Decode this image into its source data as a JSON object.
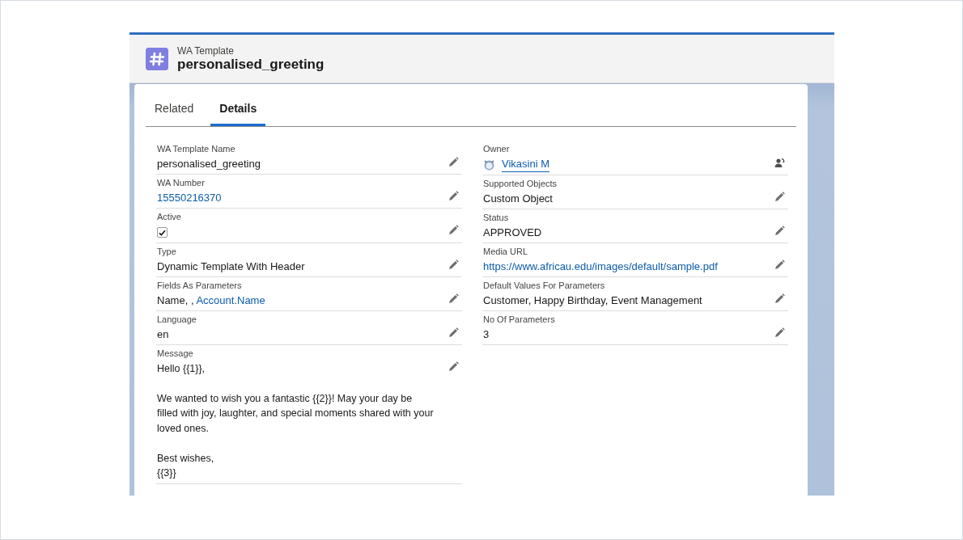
{
  "header": {
    "object_label": "WA Template",
    "record_name": "personalised_greeting"
  },
  "tabs": [
    {
      "label": "Related",
      "selected": false
    },
    {
      "label": "Details",
      "selected": true
    }
  ],
  "left_fields": [
    {
      "label": "WA Template Name",
      "kind": "text",
      "value": "personalised_greeting",
      "editable": true
    },
    {
      "label": "WA Number",
      "kind": "link",
      "value": "15550216370",
      "editable": true
    },
    {
      "label": "Active",
      "kind": "checkbox",
      "checked": true,
      "editable": true
    },
    {
      "label": "Type",
      "kind": "text",
      "value": "Dynamic Template With Header",
      "editable": true
    },
    {
      "label": "Fields As Parameters",
      "kind": "mixed",
      "value": "Name, , ",
      "link": "Account.Name",
      "editable": true
    },
    {
      "label": "Language",
      "kind": "text",
      "value": "en",
      "editable": true
    },
    {
      "label": "Message",
      "kind": "multiline",
      "paragraphs": [
        [
          "Hello {{1}},"
        ],
        [
          "We wanted to wish you a fantastic {{2}}! May your day be",
          "filled with joy, laughter, and special moments shared with your",
          "loved ones."
        ],
        [
          "Best wishes,",
          "{{3}}"
        ]
      ],
      "editable": true
    }
  ],
  "right_fields": [
    {
      "label": "Owner",
      "kind": "owner",
      "value": "Vikasini M",
      "editable": true
    },
    {
      "label": "Supported Objects",
      "kind": "text",
      "value": "Custom Object",
      "editable": true
    },
    {
      "label": "Status",
      "kind": "text",
      "value": "APPROVED",
      "editable": true
    },
    {
      "label": "Media URL",
      "kind": "link",
      "value": "https://www.africau.edu/images/default/sample.pdf",
      "editable": true
    },
    {
      "label": "Default Values For Parameters",
      "kind": "text",
      "value": "Customer, Happy Birthday, Event Management",
      "editable": true
    },
    {
      "label": "No Of Parameters",
      "kind": "text",
      "value": "3",
      "editable": true
    }
  ]
}
